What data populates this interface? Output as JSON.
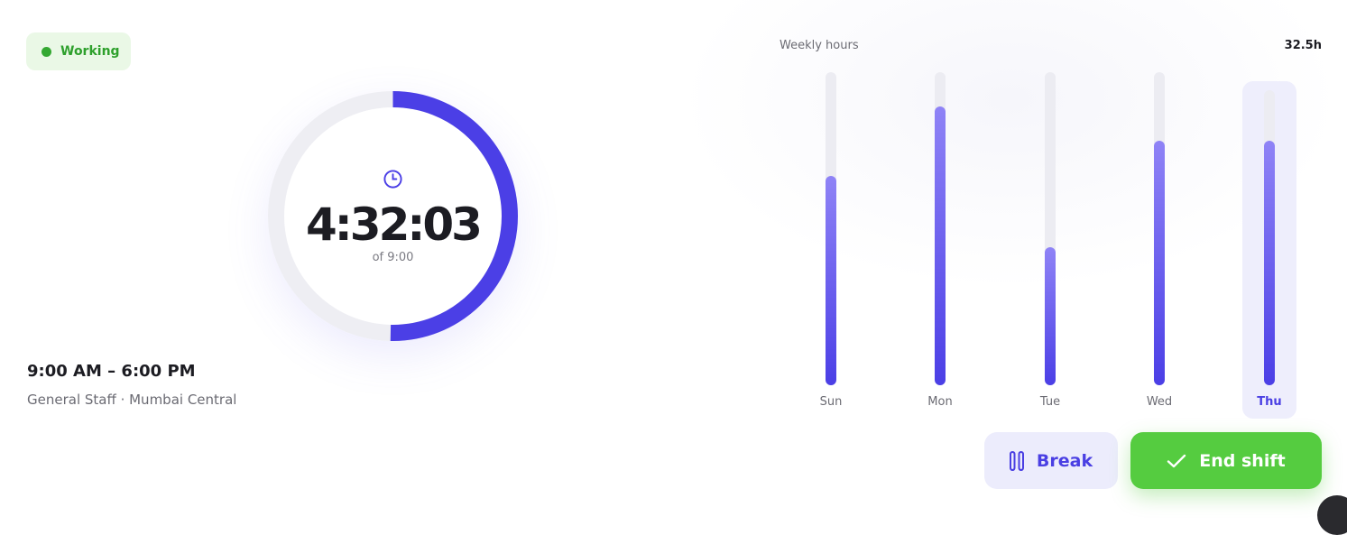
{
  "status": {
    "label": "Working",
    "color": "#34a832"
  },
  "timer": {
    "elapsed": "4:32:03",
    "total": "of 9:00",
    "progress": 0.503,
    "accent": "#4b3fe6",
    "icon": "clock-icon"
  },
  "shift": {
    "time_range": "9:00 AM – 6:00 PM",
    "meta": "General Staff · Mumbai Central"
  },
  "weekly": {
    "label": "Weekly hours",
    "total": "32.5h",
    "days": [
      {
        "label": "Sun",
        "fraction": 0.67,
        "active": false
      },
      {
        "label": "Mon",
        "fraction": 0.89,
        "active": false
      },
      {
        "label": "Tue",
        "fraction": 0.44,
        "active": false
      },
      {
        "label": "Wed",
        "fraction": 0.78,
        "active": false
      },
      {
        "label": "Thu",
        "fraction": 0.83,
        "active": true
      }
    ]
  },
  "actions": {
    "break_label": "Break",
    "break_icon": "pause-icon",
    "end_label": "End shift",
    "end_icon": "check-icon"
  }
}
